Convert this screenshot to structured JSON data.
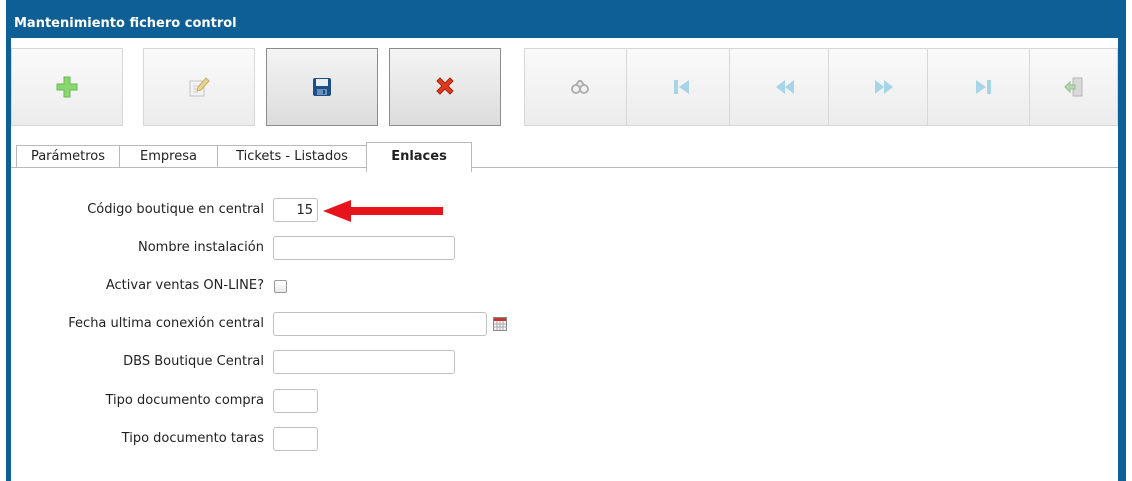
{
  "window": {
    "title": "Mantenimiento fichero control"
  },
  "toolbar": {
    "buttons": [
      {
        "icon": "plus-icon",
        "color": "#7fd36a",
        "state": "enabled"
      },
      {
        "icon": "edit-icon",
        "color": "#c0c0c0",
        "state": "disabled"
      },
      {
        "icon": "save-icon",
        "color": "#1b4f86",
        "state": "enabled"
      },
      {
        "icon": "delete-icon",
        "color": "#e03a1e",
        "state": "enabled"
      },
      {
        "icon": "binoculars-icon",
        "color": "#b0b0b0",
        "state": "disabled"
      },
      {
        "icon": "first-record-icon",
        "color": "#a8d4e8",
        "state": "disabled"
      },
      {
        "icon": "previous-record-icon",
        "color": "#a8d4e8",
        "state": "disabled"
      },
      {
        "icon": "next-record-icon",
        "color": "#a8d4e8",
        "state": "disabled"
      },
      {
        "icon": "last-record-icon",
        "color": "#a8d4e8",
        "state": "disabled"
      },
      {
        "icon": "exit-icon",
        "color": "#b6d9b0",
        "state": "disabled"
      }
    ]
  },
  "tabs": [
    {
      "label": "Parámetros",
      "active": false
    },
    {
      "label": "Empresa",
      "active": false
    },
    {
      "label": "Tickets - Listados",
      "active": false
    },
    {
      "label": "Enlaces",
      "active": true
    }
  ],
  "form": {
    "codigo_boutique": {
      "label": "Código boutique en central",
      "value": "15"
    },
    "nombre_instalacion": {
      "label": "Nombre instalación",
      "value": ""
    },
    "activar_ventas": {
      "label": "Activar ventas ON-LINE?",
      "checked": false
    },
    "fecha_conexion": {
      "label": "Fecha ultima conexión central",
      "value": ""
    },
    "dbs_boutique": {
      "label": "DBS Boutique Central",
      "value": ""
    },
    "tipo_doc_compra": {
      "label": "Tipo documento compra",
      "value": ""
    },
    "tipo_doc_taras": {
      "label": "Tipo documento taras",
      "value": ""
    }
  },
  "annotation": {
    "arrow_color": "#e8141b"
  },
  "colors": {
    "titlebar": "#0e5f96"
  }
}
